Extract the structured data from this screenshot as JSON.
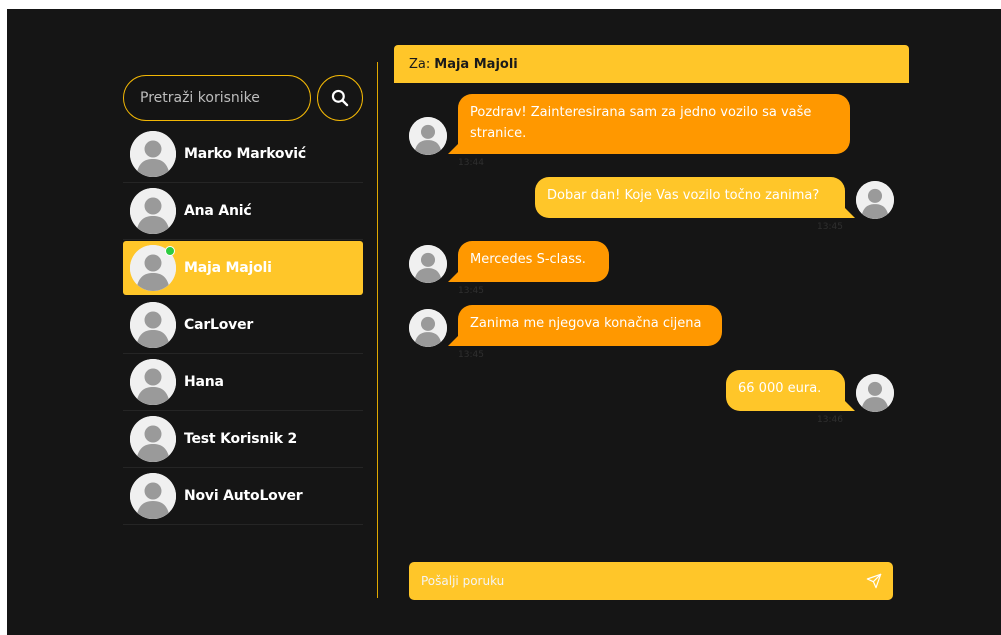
{
  "search": {
    "placeholder": "Pretraži korisnike",
    "icon": "search-icon"
  },
  "contacts": [
    {
      "name": "Marko Marković",
      "active": false,
      "online": false
    },
    {
      "name": "Ana Anić",
      "active": false,
      "online": false
    },
    {
      "name": "Maja Majoli",
      "active": true,
      "online": true
    },
    {
      "name": "CarLover",
      "active": false,
      "online": false
    },
    {
      "name": "Hana",
      "active": false,
      "online": false
    },
    {
      "name": "Test Korisnik 2",
      "active": false,
      "online": false
    },
    {
      "name": "Novi AutoLover",
      "active": false,
      "online": false
    }
  ],
  "chat": {
    "to_label": "Za:",
    "to_name": "Maja Majoli",
    "messages": [
      {
        "direction": "in",
        "text": "Pozdrav! Zainteresirana sam za jedno vozilo sa vaše stranice.",
        "time": "13:44"
      },
      {
        "direction": "out",
        "text": "Dobar dan! Koje Vas vozilo točno zanima?",
        "time": "13:45"
      },
      {
        "direction": "in",
        "text": "Mercedes S-class.",
        "time": "13:45"
      },
      {
        "direction": "in",
        "text": "Zanima me njegova konačna cijena",
        "time": "13:45"
      },
      {
        "direction": "out",
        "text": "66 000 eura.",
        "time": "13:46"
      }
    ]
  },
  "composer": {
    "placeholder": "Pošalji poruku",
    "send_icon": "send-icon"
  },
  "colors": {
    "background": "#151515",
    "accent_yellow": "#ffc629",
    "accent_orange": "#ff9800",
    "online": "#2ecc40"
  }
}
